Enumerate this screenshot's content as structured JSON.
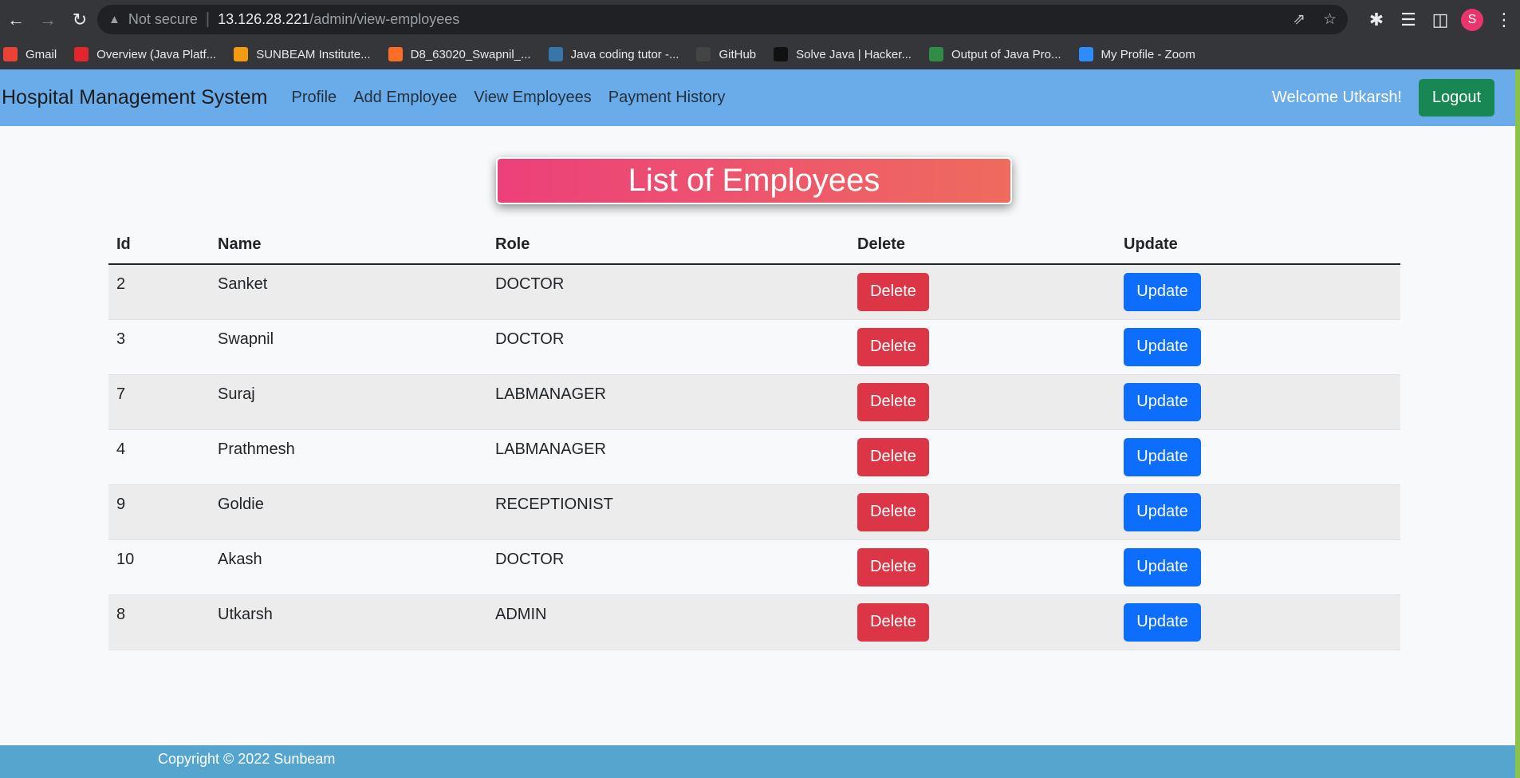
{
  "browser": {
    "security_label": "Not secure",
    "url_host": "13.126.28.221",
    "url_path": "/admin/view-employees",
    "profile_initial": "S",
    "bookmarks": [
      {
        "label": "Gmail",
        "icon": "gmail-icon",
        "color": "#ea4335"
      },
      {
        "label": "Overview (Java Platf...",
        "icon": "oracle-icon",
        "color": "#e3262b"
      },
      {
        "label": "SUNBEAM Institute...",
        "icon": "sunbeam-icon",
        "color": "#f39c12"
      },
      {
        "label": "D8_63020_Swapnil_...",
        "icon": "gitlab-icon",
        "color": "#fc6d26"
      },
      {
        "label": "Java coding tutor -...",
        "icon": "python-icon",
        "color": "#3776ab"
      },
      {
        "label": "GitHub",
        "icon": "github-icon",
        "color": "#444444"
      },
      {
        "label": "Solve Java | Hacker...",
        "icon": "hackerrank-icon",
        "color": "#111111"
      },
      {
        "label": "Output of Java Pro...",
        "icon": "geeksforgeeks-icon",
        "color": "#2f8d46"
      },
      {
        "label": "My Profile - Zoom",
        "icon": "zoom-icon",
        "color": "#2d8cff"
      }
    ]
  },
  "navbar": {
    "brand": "Hospital Management System",
    "links": [
      "Profile",
      "Add Employee",
      "View Employees",
      "Payment History"
    ],
    "welcome": "Welcome Utkarsh!",
    "logout_label": "Logout"
  },
  "page": {
    "title": "List of Employees"
  },
  "table": {
    "headers": [
      "Id",
      "Name",
      "Role",
      "Delete",
      "Update"
    ],
    "delete_label": "Delete",
    "update_label": "Update",
    "rows": [
      {
        "id": "2",
        "name": "Sanket",
        "role": "DOCTOR"
      },
      {
        "id": "3",
        "name": "Swapnil",
        "role": "DOCTOR"
      },
      {
        "id": "7",
        "name": "Suraj",
        "role": "LABMANAGER"
      },
      {
        "id": "4",
        "name": "Prathmesh",
        "role": "LABMANAGER"
      },
      {
        "id": "9",
        "name": "Goldie",
        "role": "RECEPTIONIST"
      },
      {
        "id": "10",
        "name": "Akash",
        "role": "DOCTOR"
      },
      {
        "id": "8",
        "name": "Utkarsh",
        "role": "ADMIN"
      }
    ]
  },
  "footer": {
    "copyright": "Copyright © 2022 Sunbeam"
  },
  "colors": {
    "navbar_bg": "#6aace9",
    "logout_bg": "#198754",
    "delete_bg": "#dc3545",
    "update_bg": "#0d6efd",
    "footer_bg": "#56a5cf"
  }
}
